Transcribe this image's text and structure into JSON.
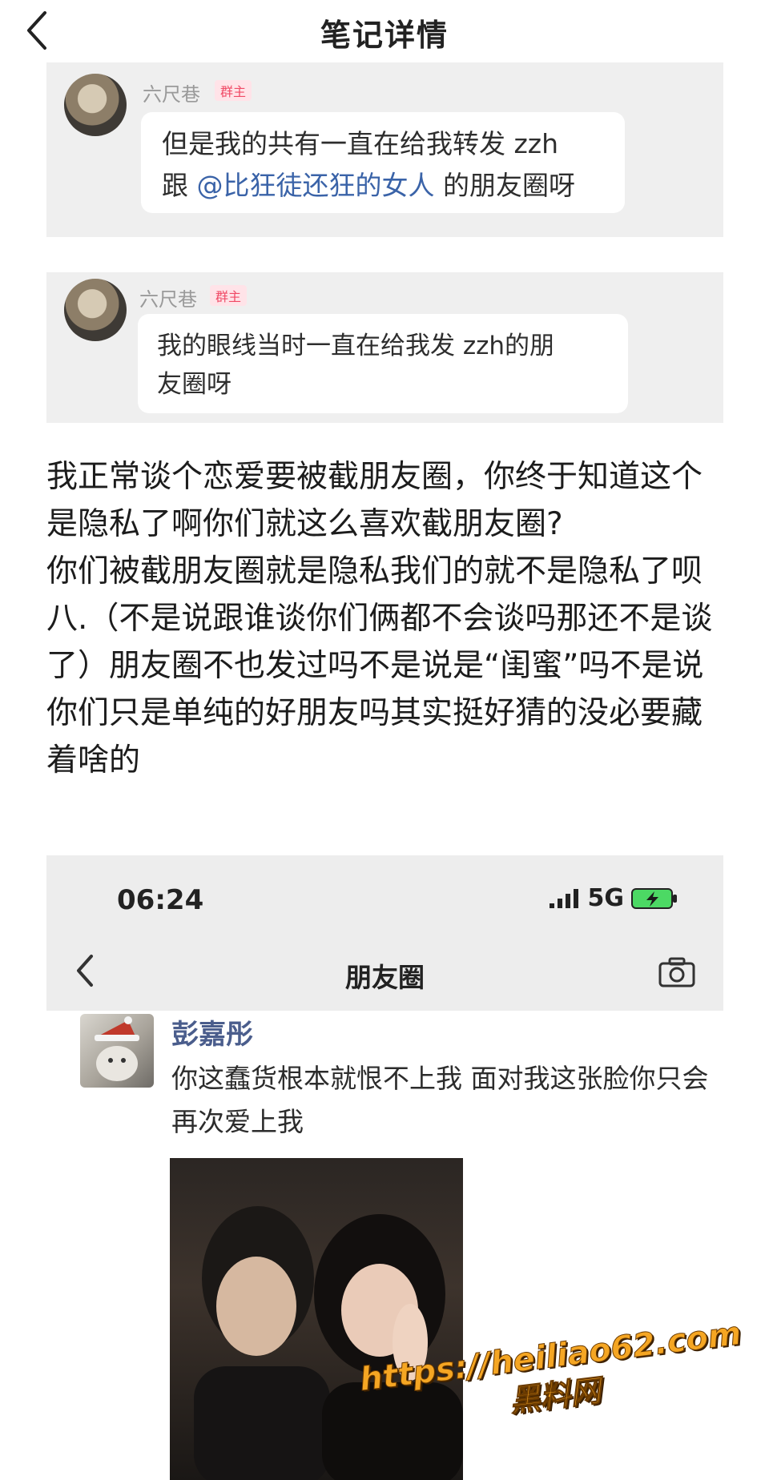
{
  "header": {
    "title": "笔记详情",
    "back_icon": "chevron-left-icon"
  },
  "comments": [
    {
      "username": "六尺巷",
      "badge": "群主",
      "text_before": "但是我的共有一直在给我转发 zzh",
      "text_line2_prefix": "跟 ",
      "mention": "@比狂徒还狂的女人",
      "text_line2_suffix": " 的朋友圈呀"
    },
    {
      "username": "六尺巷",
      "badge": "群主",
      "text_line1": "我的眼线当时一直在给我发 zzh的朋",
      "text_line2": "友圈呀"
    }
  ],
  "body": {
    "paragraphs": [
      "我正常谈个恋爱要被截朋友圈，你终于知道这个是隐私了啊你们就这么喜欢截朋友圈?",
      "你们被截朋友圈就是隐私我们的就不是隐私了呗",
      "八.（不是说跟谁谈你们俩都不会谈吗那还不是谈了）朋友圈不也发过吗不是说是“闺蜜”吗不是说你们只是单纯的好朋友吗其实挺好猜的没必要藏着啥的"
    ]
  },
  "screenshot": {
    "time": "06:24",
    "network": "5G",
    "battery": "charging",
    "page_title": "朋友圈",
    "camera_icon": "camera-icon",
    "post": {
      "author": "彭嘉彤",
      "text": "你这蠢货根本就恨不上我 面对我这张脸你只会再次爱上我"
    }
  },
  "watermark": {
    "url": "https://heiliao62.com",
    "name": "黑料网"
  },
  "colors": {
    "mention": "#3a63a8",
    "author": "#4a5d8c",
    "badge": "#f04a66",
    "watermark": "#f5a623"
  }
}
